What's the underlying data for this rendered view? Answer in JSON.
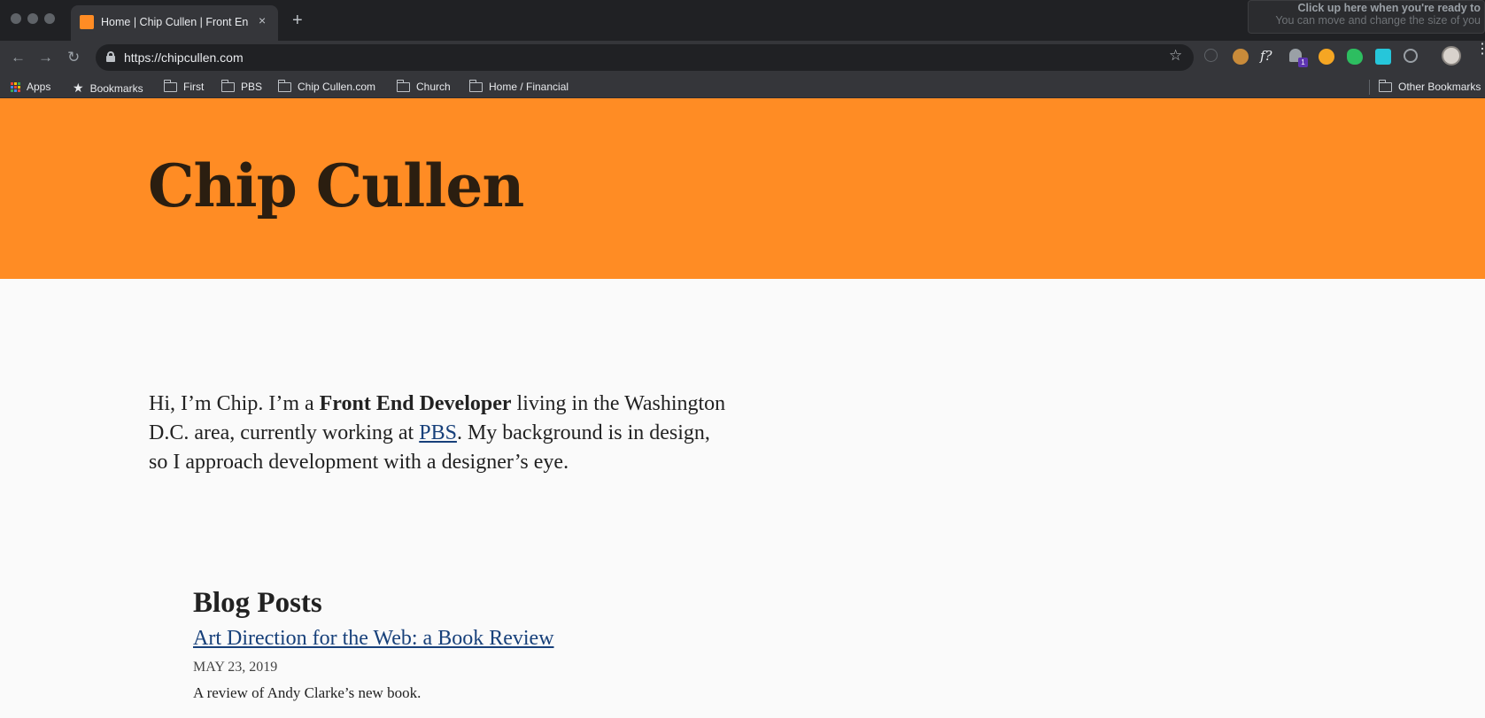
{
  "browser": {
    "tab_title": "Home | Chip Cullen | Front End Developer",
    "tab_close": "×",
    "new_tab": "+",
    "overlay": {
      "line1": "Click up here when you're ready to",
      "line2": "You can move and change the size of you"
    },
    "nav": {
      "back": "←",
      "forward": "→",
      "reload": "↻"
    },
    "url": "https://chipcullen.com",
    "star": "☆",
    "extensions": [
      {
        "icon": "info-icon",
        "color": "#5f6368"
      },
      {
        "icon": "cookie-icon",
        "color": "#c98b3a"
      },
      {
        "icon": "font-icon",
        "color": "#35363a"
      },
      {
        "icon": "ghost-icon",
        "color": "#9aa0a6",
        "badge": "1"
      },
      {
        "icon": "gear-icon",
        "color": "#f5a623"
      },
      {
        "icon": "evernote-icon",
        "color": "#2dbe60"
      },
      {
        "icon": "screenshot-icon",
        "color": "#26c6da"
      },
      {
        "icon": "wordpress-icon",
        "color": "#9aa0a6"
      }
    ],
    "bookmarks": [
      {
        "label": "Apps",
        "icon": "apps-grid-icon"
      },
      {
        "label": "Bookmarks",
        "icon": "star-icon"
      },
      {
        "label": "First",
        "icon": "folder-icon"
      },
      {
        "label": "PBS",
        "icon": "folder-icon"
      },
      {
        "label": "Chip Cullen.com",
        "icon": "folder-icon"
      },
      {
        "label": "Church",
        "icon": "folder-icon"
      },
      {
        "label": "Home / Financial",
        "icon": "folder-icon"
      }
    ],
    "other_bookmarks": "Other Bookmarks"
  },
  "page": {
    "site_title": "Chip Cullen",
    "intro": {
      "part1": "Hi, I’m Chip. I’m a ",
      "role": "Front End Developer",
      "part2": " living in the Washington D.C. area, currently working at ",
      "employer_link": "PBS",
      "part3": ". My background is in design, so I approach development with a designer’s eye."
    },
    "blog": {
      "heading": "Blog Posts",
      "posts": [
        {
          "title": "Art Direction for the Web: a Book Review",
          "date": "May 23, 2019",
          "summary": "A review of Andy Clarke’s new book."
        }
      ]
    }
  },
  "colors": {
    "header_bg": "#ff8c24",
    "link": "#17407a",
    "page_bg": "#fafafa"
  }
}
